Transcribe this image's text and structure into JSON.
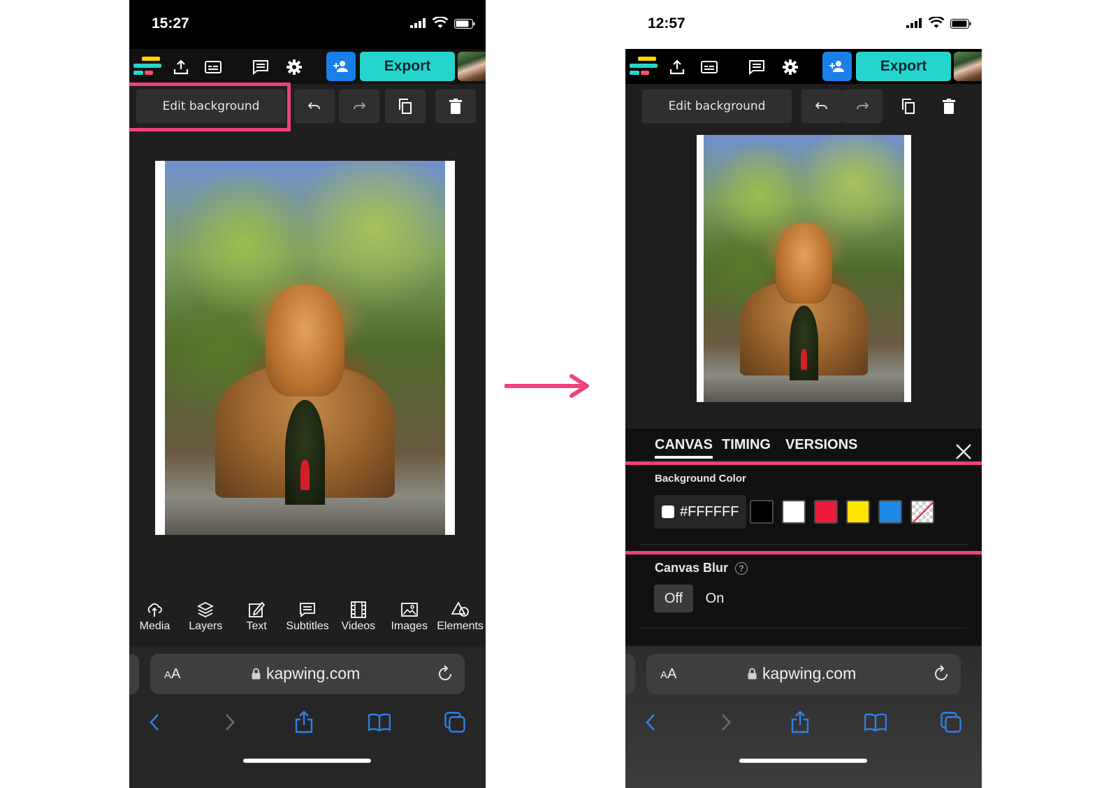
{
  "app": {
    "export_label": "Export",
    "edit_background_label": "Edit background",
    "accent_color": "#f0417f",
    "export_color": "#25d5cd",
    "invite_color": "#1a7fe8"
  },
  "left_screen": {
    "status_time": "15:27",
    "bottom_tools": [
      {
        "label": "Media",
        "icon": "upload-cloud-icon"
      },
      {
        "label": "Layers",
        "icon": "layers-icon"
      },
      {
        "label": "Text",
        "icon": "edit-text-icon"
      },
      {
        "label": "Subtitles",
        "icon": "subtitles-icon"
      },
      {
        "label": "Videos",
        "icon": "film-icon"
      },
      {
        "label": "Images",
        "icon": "image-icon"
      },
      {
        "label": "Elements",
        "icon": "shapes-icon"
      }
    ]
  },
  "right_screen": {
    "status_time": "12:57",
    "tabs": [
      {
        "label": "CANVAS",
        "active": true
      },
      {
        "label": "TIMING",
        "active": false
      },
      {
        "label": "VERSIONS",
        "active": false
      }
    ],
    "background_color_label": "Background Color",
    "background_color_value": "#FFFFFF",
    "swatches": [
      "#000000",
      "#FFFFFF",
      "#ED1B3A",
      "#FFE500",
      "#1E88E5",
      "transparent"
    ],
    "canvas_blur_label": "Canvas Blur",
    "blur_options": [
      "Off",
      "On"
    ],
    "blur_selected": "Off"
  },
  "safari": {
    "aa_label_big": "A",
    "aa_label_small": "A",
    "host": "kapwing.com"
  }
}
